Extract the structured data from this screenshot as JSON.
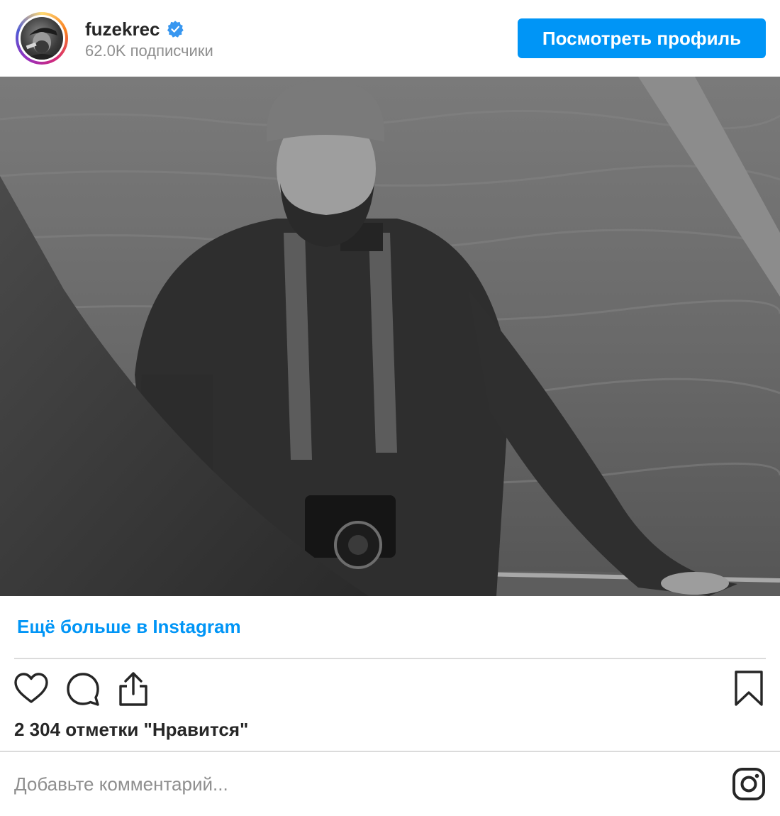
{
  "header": {
    "username": "fuzekrec",
    "followers": "62.0K подписчики",
    "verified_icon": "verified-badge-icon",
    "view_profile_label": "Посмотреть профиль"
  },
  "post": {
    "more_link": "Ещё больше в Instagram",
    "likes_text": "2 304 отметки \"Нравится\"",
    "comment_placeholder": "Добавьте комментарий..."
  },
  "icons": {
    "like": "heart-icon",
    "comment": "comment-bubble-icon",
    "share": "share-icon",
    "bookmark": "bookmark-icon",
    "brand": "instagram-logo-icon"
  },
  "colors": {
    "accent": "#0095f6",
    "text": "#262626",
    "muted": "#8e8e8e",
    "divider": "#dbdbdb"
  }
}
